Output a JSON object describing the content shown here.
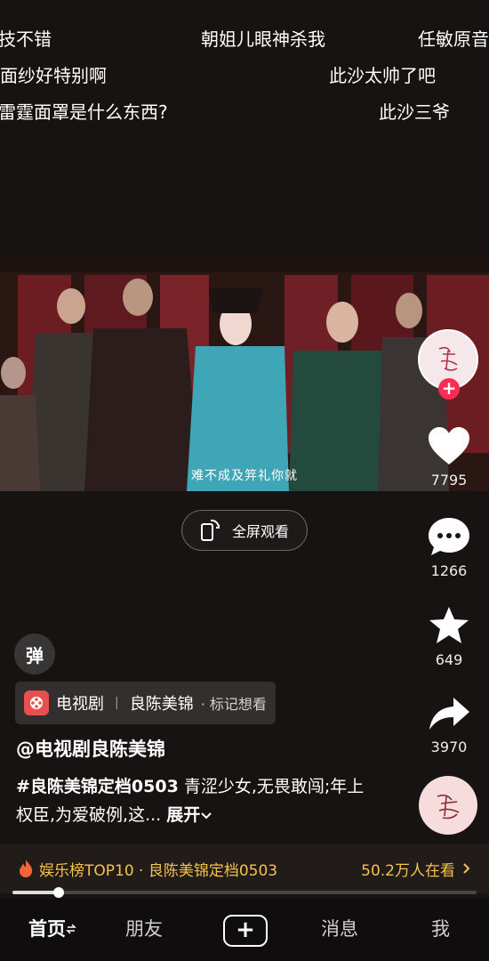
{
  "danmaku": [
    "技不错",
    "朝姐儿眼神杀我",
    "任敏原音",
    "面纱好特别啊",
    "此沙太帅了吧",
    "雷霆面罩是什么东西?",
    "此沙三爷"
  ],
  "video": {
    "subtitle": "难不成及笄礼你就"
  },
  "fullscreen": {
    "label": "全屏观看"
  },
  "actions": {
    "likes": "7795",
    "comments": "1266",
    "favorites": "649",
    "shares": "3970"
  },
  "danmaku_toggle": {
    "label": "弹"
  },
  "tag": {
    "category": "电视剧",
    "title": "良陈美锦",
    "action": "· 标记想看"
  },
  "post": {
    "author": "@电视剧良陈美锦",
    "hashtag": "#良陈美锦定档0503",
    "text": " 青涩少女,无畏敢闯;年上权臣,为爱破例,这...",
    "expand": "展开"
  },
  "hot": {
    "label": "娱乐榜TOP10 · 良陈美锦定档0503",
    "viewers": "50.2万人在看"
  },
  "progress": {
    "fraction": 0.1
  },
  "nav": {
    "home": "首页",
    "friends": "朋友",
    "plus": "+",
    "messages": "消息",
    "me": "我"
  },
  "colors": {
    "accent": "#fe2c55",
    "hot": "#f6c34a"
  }
}
